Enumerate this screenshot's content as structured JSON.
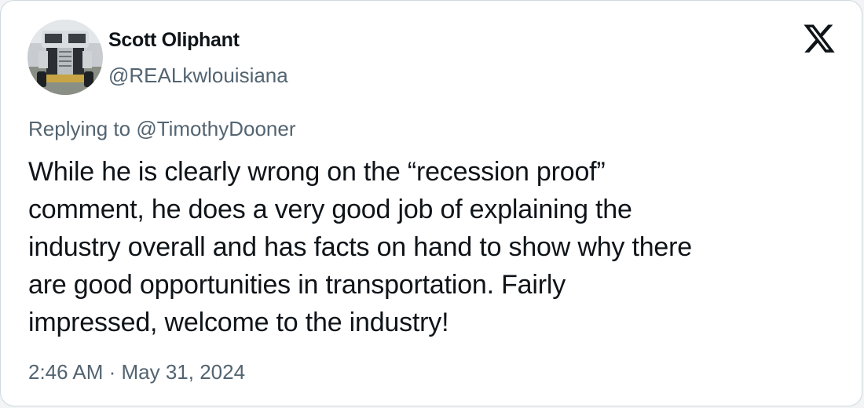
{
  "author": {
    "display_name": "Scott Oliphant",
    "handle": "@REALkwlouisiana",
    "avatar": "truck-avatar"
  },
  "brand": {
    "logo": "x-logo-icon"
  },
  "reply": {
    "prefix": "Replying to ",
    "mention": "@TimothyDooner"
  },
  "tweet": {
    "text": "While he is clearly wrong on the “recession proof”\ncomment, he does a very good job of explaining the\nindustry overall and has facts on hand to show why there\nare good opportunities in transportation.  Fairly\nimpressed, welcome to the industry!"
  },
  "meta": {
    "timestamp": "2:46 AM · May 31, 2024"
  },
  "colors": {
    "text": "#0f1419",
    "secondary": "#536471",
    "border": "#cfd9de"
  }
}
